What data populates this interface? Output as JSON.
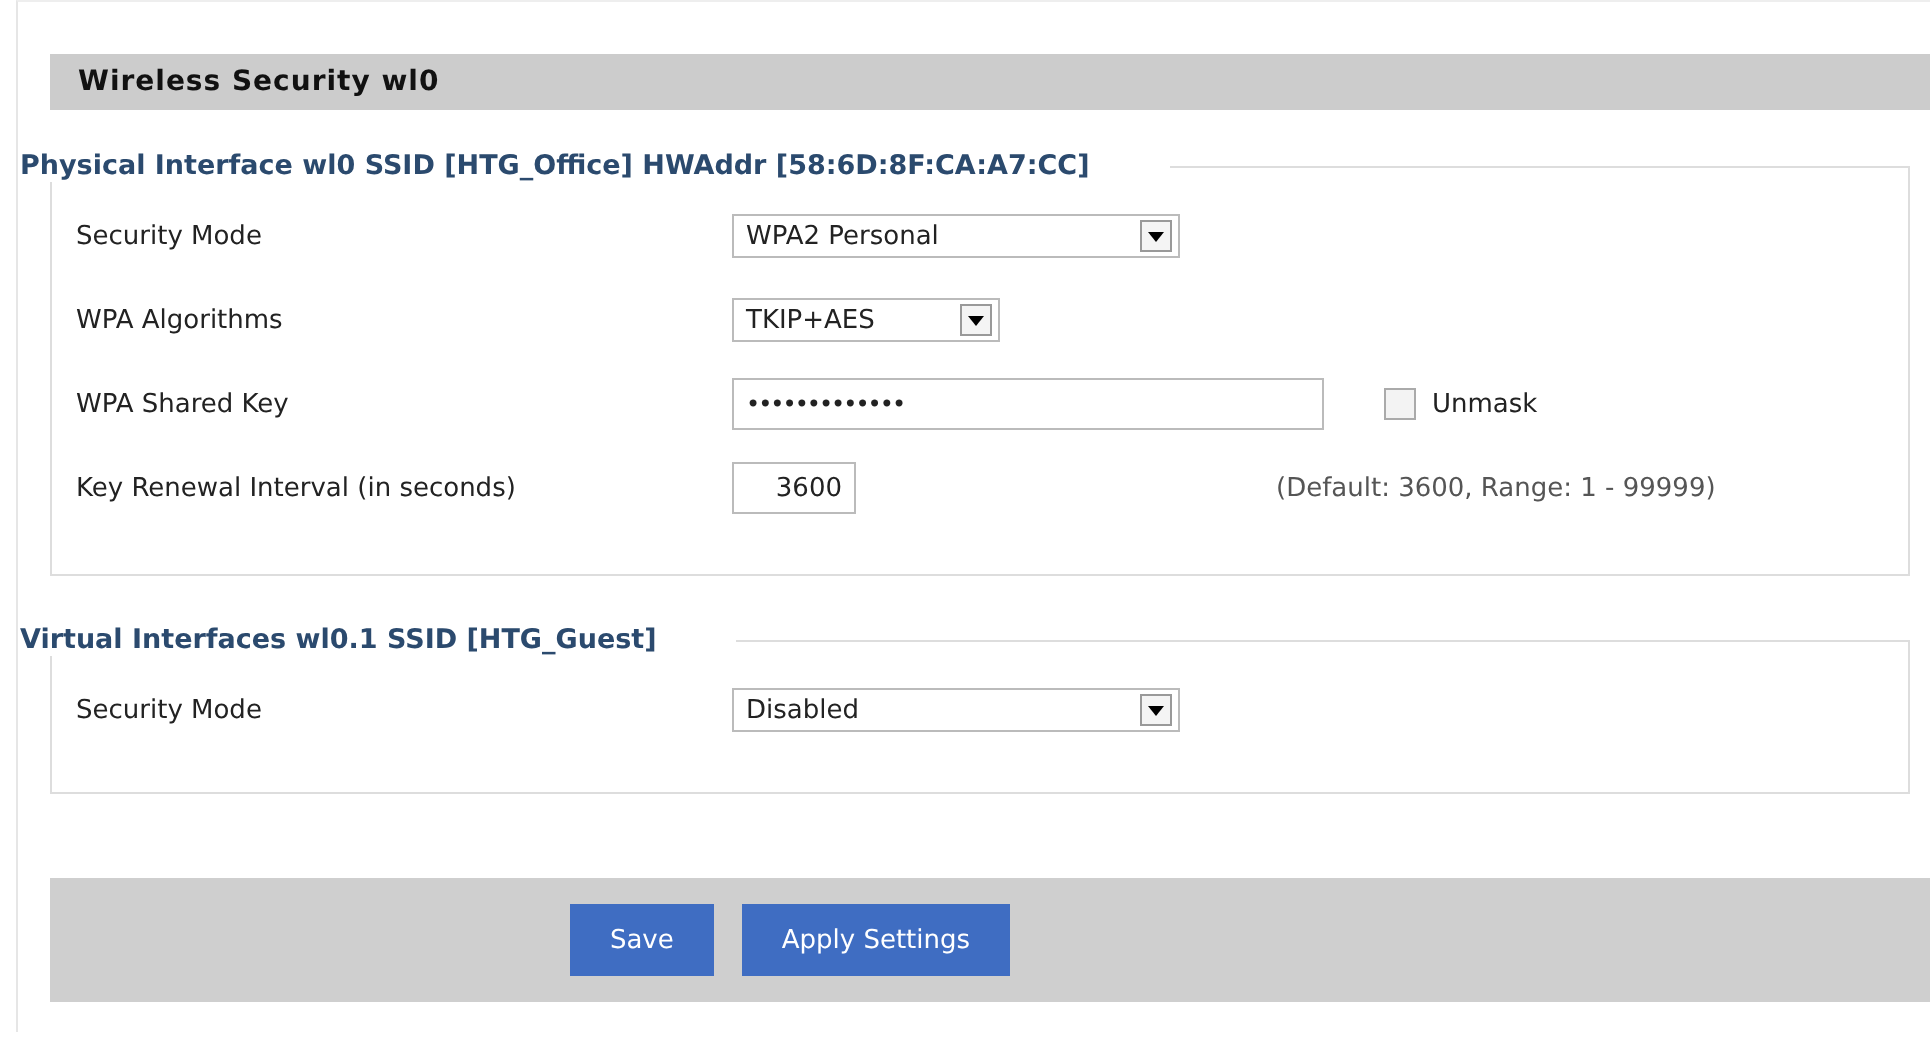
{
  "title": "Wireless Security wl0",
  "sections": [
    {
      "legend": "Physical Interface wl0 SSID [HTG_Office] HWAddr [58:6D:8F:CA:A7:CC]",
      "rows": [
        {
          "kind": "select",
          "label": "Security Mode",
          "value": "WPA2 Personal"
        },
        {
          "kind": "short-select",
          "label": "WPA Algorithms",
          "value": "TKIP+AES"
        },
        {
          "kind": "password",
          "label": "WPA Shared Key",
          "value": "•••••••••••••",
          "checkbox": {
            "label": "Unmask",
            "checked": false
          }
        },
        {
          "kind": "number",
          "label": "Key Renewal Interval (in seconds)",
          "value": "3600",
          "hint": "(Default: 3600, Range: 1 - 99999)"
        }
      ]
    },
    {
      "legend": "Virtual Interfaces wl0.1 SSID [HTG_Guest]",
      "rows": [
        {
          "kind": "select",
          "label": "Security Mode",
          "value": "Disabled"
        }
      ]
    }
  ],
  "buttons": [
    "Save",
    "Apply Settings"
  ]
}
